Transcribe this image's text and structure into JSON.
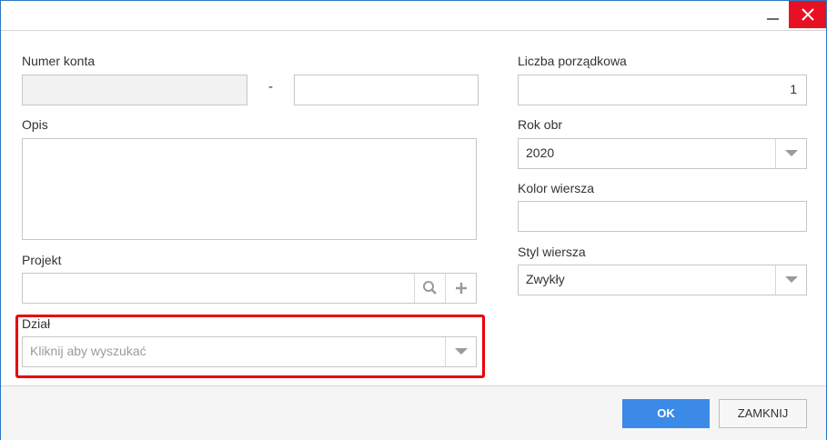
{
  "window": {
    "minimize_icon": "minimize-icon",
    "close_icon": "close-icon"
  },
  "form": {
    "numer_konta": {
      "label": "Numer konta",
      "value_part1": "",
      "separator": "-",
      "value_part2": ""
    },
    "opis": {
      "label": "Opis",
      "value": ""
    },
    "projekt": {
      "label": "Projekt",
      "value": "",
      "search_icon": "search-icon",
      "add_icon": "plus-icon"
    },
    "dzial": {
      "label": "Dział",
      "placeholder": "Kliknij aby wyszukać"
    },
    "liczba_porzadkowa": {
      "label": "Liczba porządkowa",
      "value": "1"
    },
    "rok_obr": {
      "label": "Rok obr",
      "value": "2020"
    },
    "kolor_wiersza": {
      "label": "Kolor wiersza",
      "value": ""
    },
    "styl_wiersza": {
      "label": "Styl wiersza",
      "value": "Zwykły"
    }
  },
  "footer": {
    "ok_label": "OK",
    "close_label": "ZAMKNIJ"
  },
  "colors": {
    "accent": "#3c8ae8",
    "close_button": "#e81123",
    "highlight": "#e8000d"
  }
}
